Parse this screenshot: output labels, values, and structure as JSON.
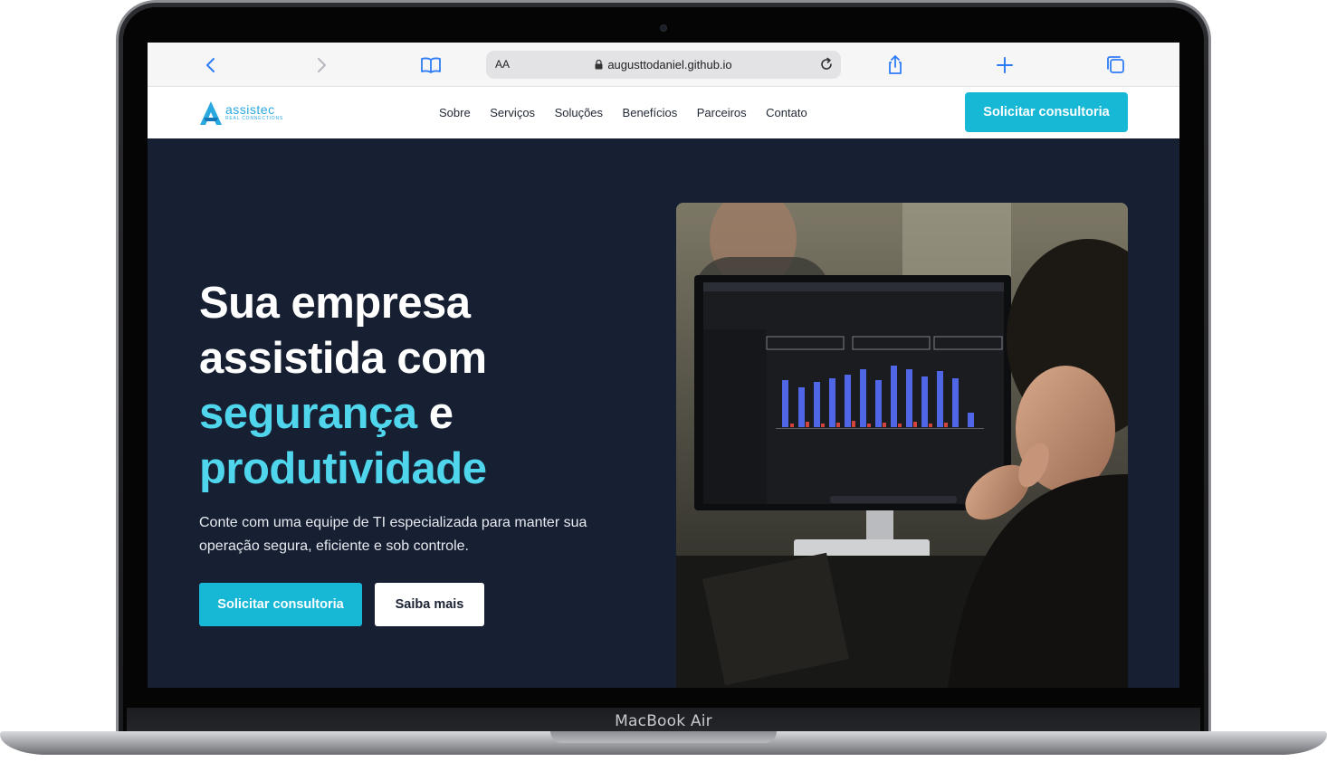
{
  "browser": {
    "address_prefix": "AA",
    "url": "augusttodaniel.github.io"
  },
  "site": {
    "logo": {
      "word": "assistec",
      "tagline": "REAL CONNECTIONS"
    },
    "nav_items": [
      "Sobre",
      "Serviços",
      "Soluções",
      "Benefícios",
      "Parceiros",
      "Contato"
    ],
    "nav_cta": "Solicitar consultoria"
  },
  "hero": {
    "title_line1": "Sua empresa",
    "title_line2": "assistida com",
    "title_accent1": "segurança",
    "title_join": " e",
    "title_accent2": "produtividade",
    "subtitle": "Conte com uma equipe de TI especializada para manter sua operação segura, eficiente e sob controle.",
    "primary_button": "Solicitar consultoria",
    "secondary_button": "Saiba mais"
  },
  "device": {
    "label": "MacBook Air"
  },
  "colors": {
    "accent": "#17b7d6",
    "accent_text": "#4fd6ec",
    "hero_bg": "#172033"
  }
}
